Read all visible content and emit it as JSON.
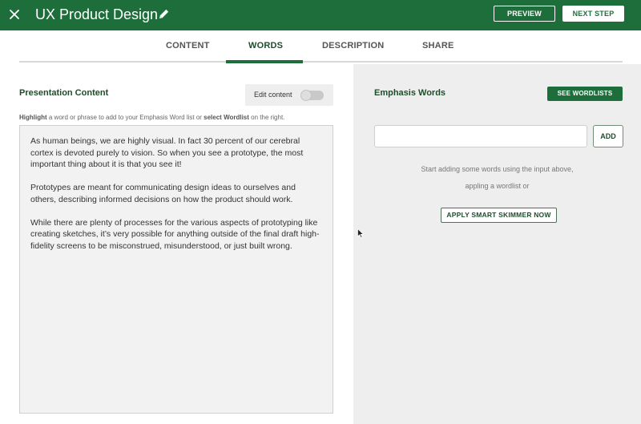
{
  "header": {
    "title": "UX Product Design",
    "preview_label": "PREVIEW",
    "next_label": "NEXT STEP",
    "close_icon": "close-icon",
    "edit_icon": "pencil-icon",
    "brand_color": "#1e6e3c"
  },
  "tabs": [
    {
      "label": "CONTENT",
      "active": false
    },
    {
      "label": "WORDS",
      "active": true
    },
    {
      "label": "DESCRIPTION",
      "active": false
    },
    {
      "label": "SHARE",
      "active": false
    }
  ],
  "left": {
    "title": "Presentation Content",
    "toggle_label": "Edit content",
    "toggle_on": false,
    "hint": {
      "part1": "Highlight",
      "part2": " a word or phrase to add to your Emphasis Word list or ",
      "part3": "select Wordlist",
      "part4": " on the right."
    },
    "paragraphs": [
      "As human beings, we are highly visual. In fact 30 percent of our cerebral cortex is devoted purely to vision. So when you see a prototype, the most important thing about it is that you see it!",
      "Prototypes are meant for communicating design ideas to ourselves and others, describing informed decisions on how the product should work.",
      "While there are plenty of processes for the various aspects of prototyping like creating sketches, it’s very possible for anything outside of the final draft high-fidelity screens to be misconstrued, misunderstood, or just built wrong."
    ]
  },
  "right": {
    "title": "Emphasis Words",
    "wordlists_label": "SEE WORDLISTS",
    "input_value": "",
    "input_placeholder": "",
    "add_label": "ADD",
    "empty_line1": "Start adding some words using the input above,",
    "empty_line2": "appling a wordlist or",
    "smart_label": "APPLY SMART SKIMMER NOW"
  }
}
